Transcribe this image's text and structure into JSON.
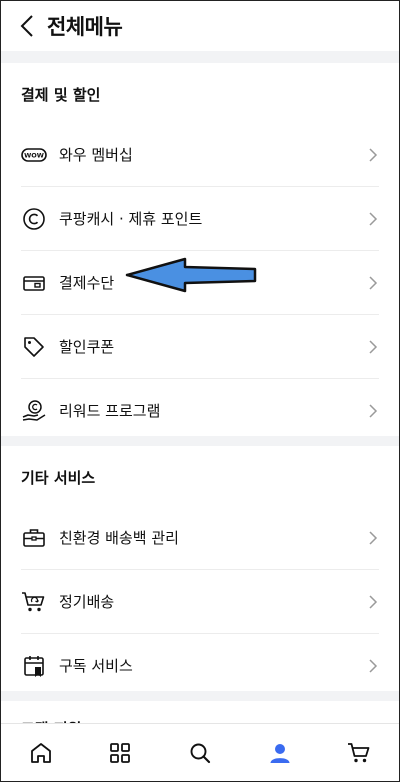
{
  "header": {
    "title": "전체메뉴"
  },
  "sections": [
    {
      "title": "결제 및 할인",
      "items": [
        {
          "label": "와우 멤버십",
          "icon": "wow-badge-icon"
        },
        {
          "label": "쿠팡캐시 · 제휴 포인트",
          "icon": "copyright-icon"
        },
        {
          "label": "결제수단",
          "icon": "wallet-card-icon"
        },
        {
          "label": "할인쿠폰",
          "icon": "tag-icon"
        },
        {
          "label": "리워드 프로그램",
          "icon": "coin-hand-icon"
        }
      ]
    },
    {
      "title": "기타 서비스",
      "items": [
        {
          "label": "친환경 배송백 관리",
          "icon": "briefcase-icon"
        },
        {
          "label": "정기배송",
          "icon": "recurring-cart-icon"
        },
        {
          "label": "구독 서비스",
          "icon": "calendar-bookmark-icon"
        }
      ]
    },
    {
      "title": "고객 지원"
    }
  ],
  "wow_badge_text": "WOW",
  "tabbar": [
    "home-icon",
    "category-grid-icon",
    "search-icon",
    "profile-icon",
    "cart-icon"
  ],
  "colors": {
    "accent_blue": "#3a6bf0",
    "arrow_fill": "#4a90e2",
    "divider": "#f2f3f5"
  }
}
